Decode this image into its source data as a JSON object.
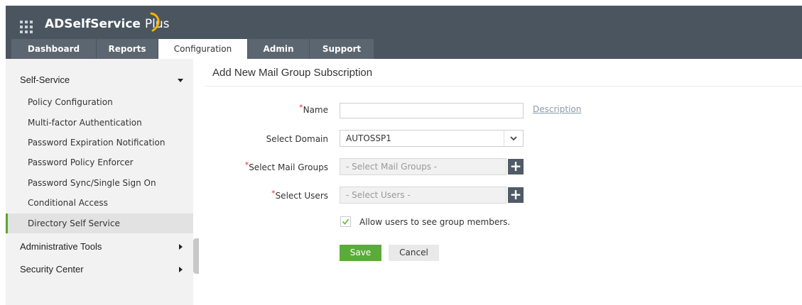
{
  "app": {
    "brand_main": "ADSelfService ",
    "brand_plus": "Plus"
  },
  "nav": {
    "tabs": [
      {
        "label": "Dashboard"
      },
      {
        "label": "Reports"
      },
      {
        "label": "Configuration",
        "active": true
      },
      {
        "label": "Admin"
      },
      {
        "label": "Support"
      }
    ]
  },
  "sidebar": {
    "section_self_service": "Self-Service",
    "items": [
      {
        "label": "Policy Configuration"
      },
      {
        "label": "Multi-factor Authentication"
      },
      {
        "label": "Password Expiration Notification"
      },
      {
        "label": "Password Policy Enforcer"
      },
      {
        "label": "Password Sync/Single Sign On"
      },
      {
        "label": "Conditional Access"
      },
      {
        "label": "Directory Self Service",
        "selected": true
      }
    ],
    "section_admin_tools": "Administrative Tools",
    "section_security_center": "Security Center"
  },
  "page": {
    "title": "Add New Mail Group Subscription"
  },
  "form": {
    "required_mark": "*",
    "name_label": "Name",
    "name_value": "",
    "description_link": "Description",
    "domain_label": "Select Domain",
    "domain_value": "AUTOSSP1",
    "mail_groups_label": "Select Mail Groups",
    "mail_groups_placeholder": "- Select Mail Groups -",
    "users_label": "Select Users",
    "users_placeholder": "- Select Users -",
    "plus_symbol": "+",
    "allow_checkbox_label": "Allow users to see group members.",
    "allow_checked": true,
    "save_label": "Save",
    "cancel_label": "Cancel"
  },
  "colors": {
    "header_bg": "#4a555f",
    "tab_bg": "#5b6670",
    "accent_green": "#5aab3a",
    "required_red": "#e03030",
    "sidebar_bg": "#f2f2f2"
  }
}
